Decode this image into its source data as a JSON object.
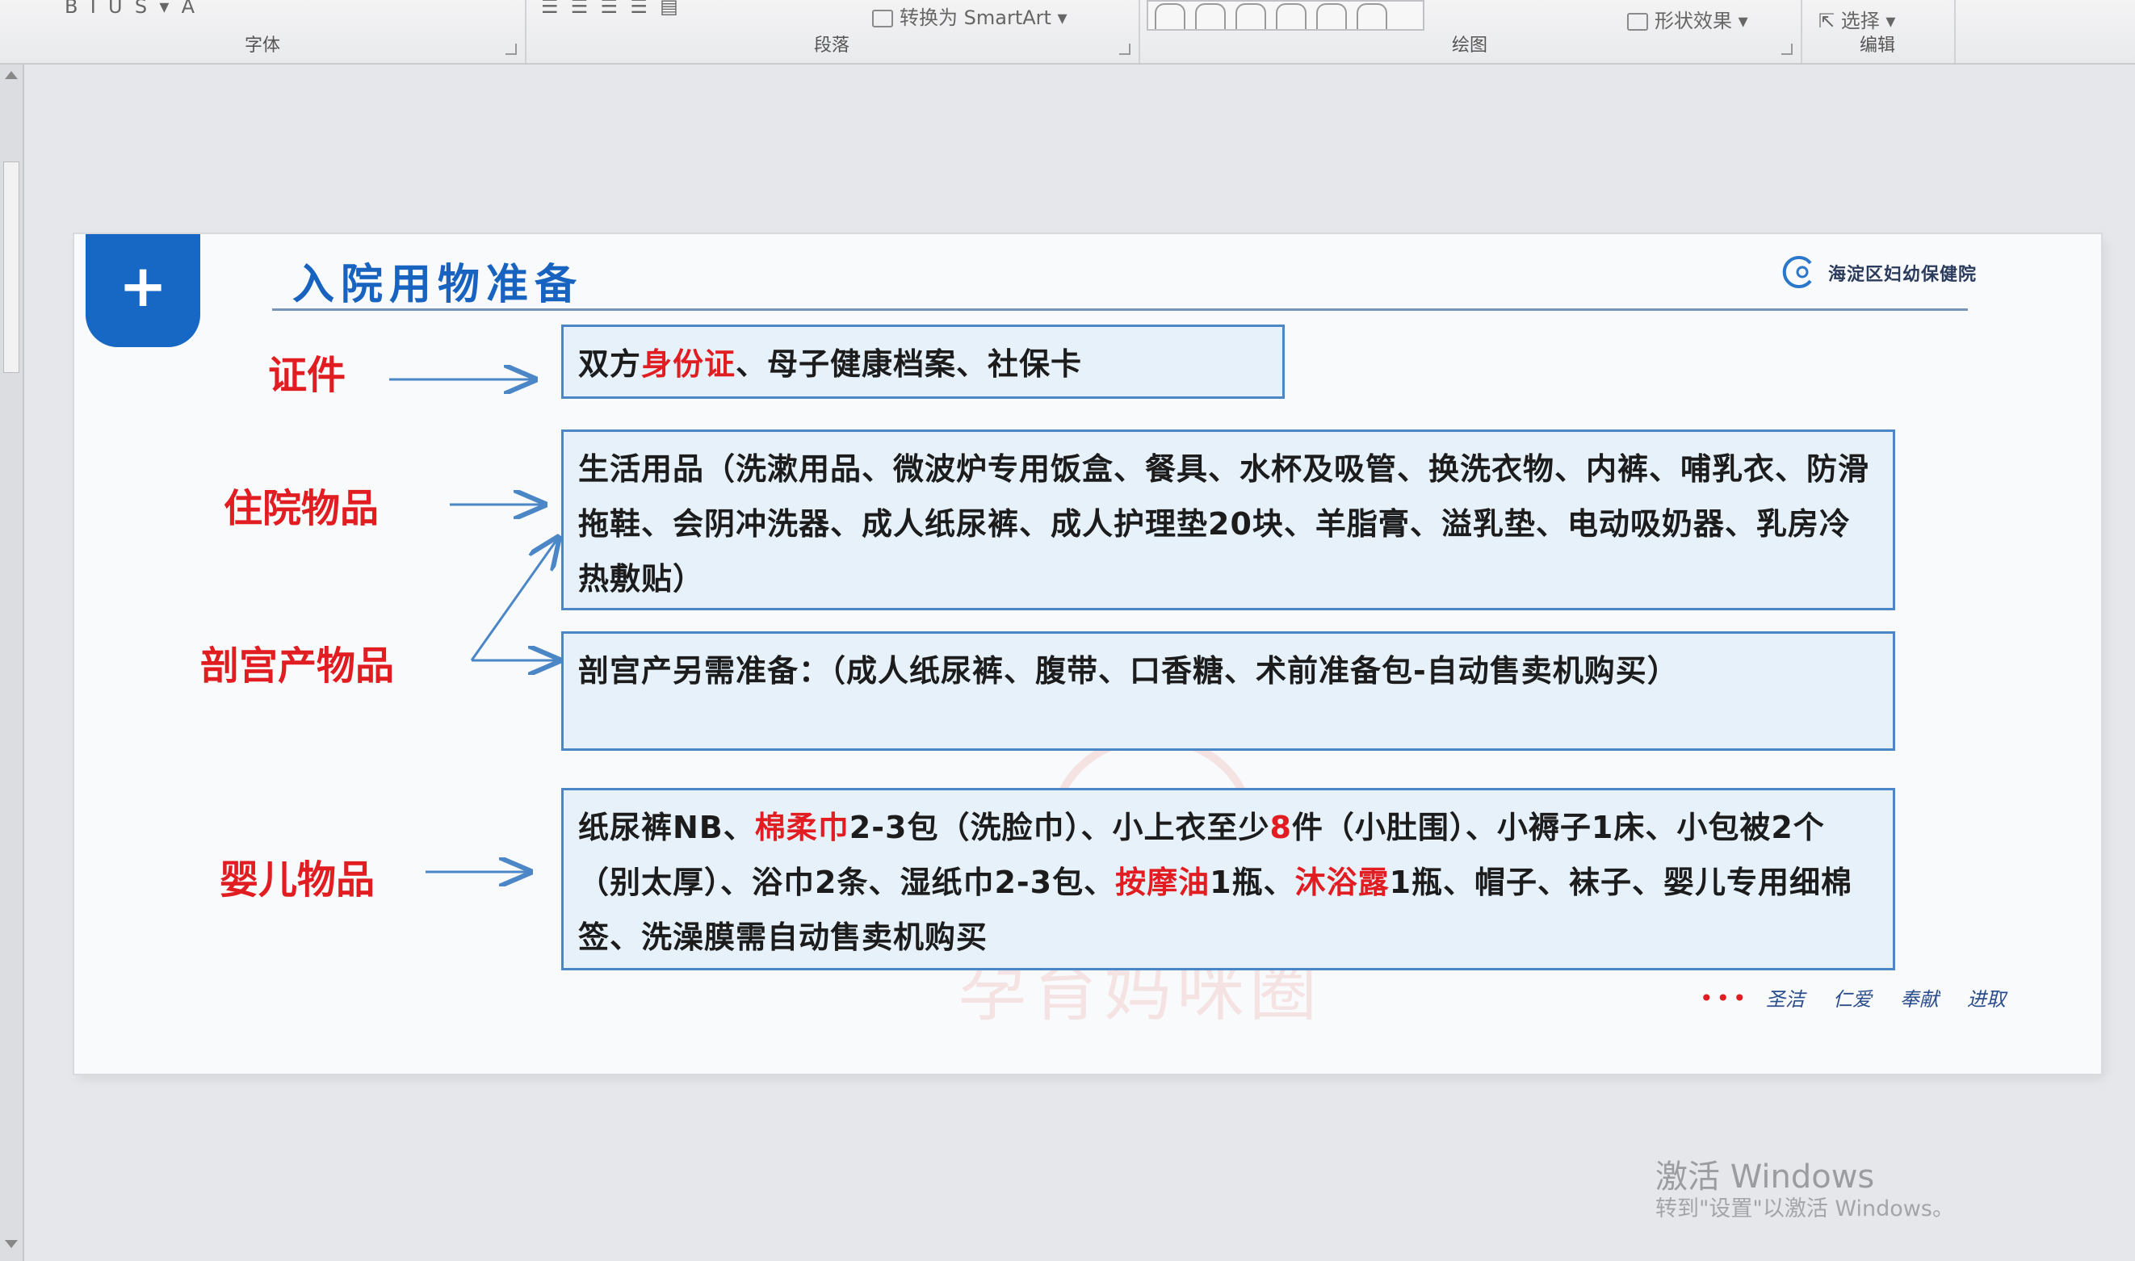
{
  "ribbon": {
    "groups": [
      "字体",
      "段落",
      "绘图",
      "编辑"
    ],
    "smartart_label": "转换为 SmartArt",
    "shape_effects_label": "形状效果",
    "select_label": "选择"
  },
  "slide": {
    "title": "入院用物准备",
    "logo_text": "海淀区妇幼保健院",
    "rows": [
      {
        "category": "证件",
        "segments": [
          {
            "text": "双方",
            "red": false
          },
          {
            "text": "身份证",
            "red": true
          },
          {
            "text": "、母子健康档案、社保卡",
            "red": false
          }
        ]
      },
      {
        "category": "住院物品",
        "segments": [
          {
            "text": "生活用品（洗漱用品、微波炉专用饭盒、餐具、水杯及吸管、换洗衣物、内裤、哺乳衣、防滑拖鞋、会阴冲洗器、成人纸尿裤、成人护理垫20块、羊脂膏、溢乳垫、电动吸奶器、乳房冷热敷贴）",
            "red": false
          }
        ]
      },
      {
        "category": "剖宫产物品",
        "segments": [
          {
            "text": "剖宫产另需准备：（成人纸尿裤、腹带、口香糖、术前准备包-自动售卖机购买）",
            "red": false
          }
        ]
      },
      {
        "category": "婴儿物品",
        "segments": [
          {
            "text": "纸尿裤NB、",
            "red": false
          },
          {
            "text": "棉柔巾",
            "red": true
          },
          {
            "text": "2-3包（洗脸巾）、小上衣至少",
            "red": false
          },
          {
            "text": "8",
            "red": true
          },
          {
            "text": "件（小肚围）、小褥子1床、小包被2个（别太厚）、浴巾2条、湿纸巾2-3包、",
            "red": false
          },
          {
            "text": "按摩油",
            "red": true
          },
          {
            "text": "1瓶、",
            "red": false
          },
          {
            "text": "沐浴露",
            "red": true
          },
          {
            "text": "1瓶、帽子、袜子、婴儿专用细棉签、洗澡膜需自动售卖机购买",
            "red": false
          }
        ]
      }
    ],
    "footer": {
      "dots": "•••",
      "words": [
        "圣洁",
        "仁爱",
        "奉献",
        "进取"
      ]
    },
    "watermark": "孕育妈咪圈"
  },
  "system": {
    "activate_title": "激活 Windows",
    "activate_sub": "转到\"设置\"以激活 Windows。"
  },
  "colors": {
    "accent_blue": "#1768c4",
    "highlight_red": "#e11d22",
    "box_fill": "#e6f1fa",
    "box_border": "#4b86c6"
  },
  "icons": [
    "plus-icon",
    "hospital-logo-icon",
    "cursor-icon"
  ]
}
